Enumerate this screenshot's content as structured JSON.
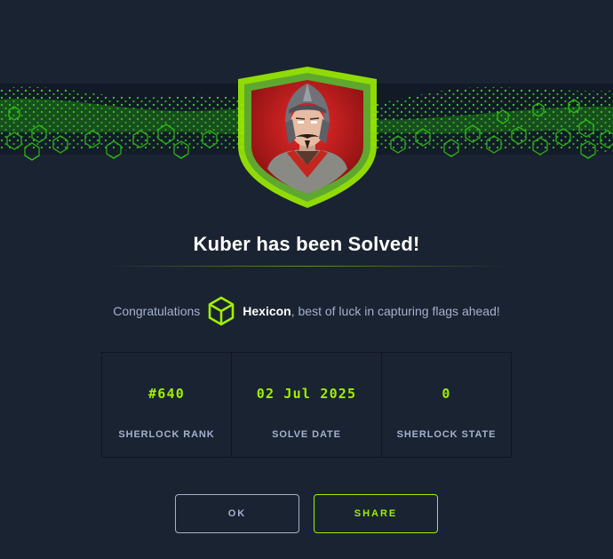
{
  "title": "Kuber has been Solved!",
  "congrats": {
    "prefix": "Congratulations",
    "username": "Hexicon",
    "suffix": ", best of luck in capturing flags ahead!"
  },
  "stats": [
    {
      "value": "#640",
      "label": "SHERLOCK RANK"
    },
    {
      "value": "02 Jul 2025",
      "label": "SOLVE DATE"
    },
    {
      "value": "0",
      "label": "SHERLOCK STATE"
    }
  ],
  "buttons": {
    "ok": "OK",
    "share": "SHARE"
  },
  "icons": {
    "banner": "green-hex-wave-banner",
    "badge": "warrior-shield-badge",
    "avatar": "green-cube-icon"
  },
  "colors": {
    "background": "#1a2332",
    "accent": "#9fef00",
    "text": "#a4b1cd",
    "title": "#ffffff",
    "badge_red": "#b31b1b"
  }
}
